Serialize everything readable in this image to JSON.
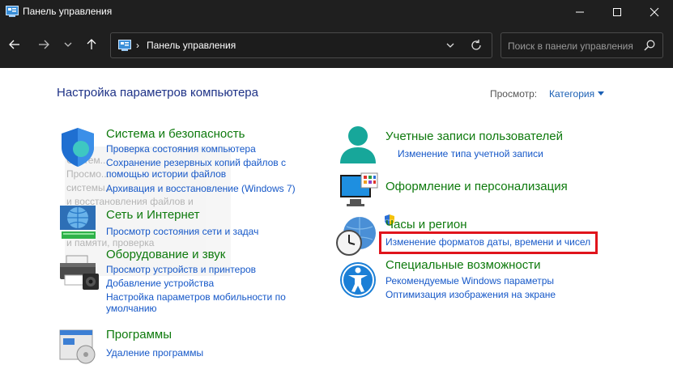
{
  "window": {
    "title": "Панель управления"
  },
  "address_bar": {
    "path": "Панель управления",
    "search_placeholder": "Поиск в панели управления"
  },
  "page": {
    "title": "Настройка параметров компьютера",
    "view_label": "Просмотр:",
    "view_value": "Категория"
  },
  "ghost_tooltip": [
    "Систем...",
    "Просмо...",
    "системы...",
    "и восстановления файлов и",
    "...",
    "и памяти, проверка"
  ],
  "categories": {
    "system": {
      "title": "Система и безопасность",
      "links": [
        "Проверка состояния компьютера",
        "Сохранение резервных копий файлов с",
        "помощью истории файлов",
        "Архивация и восстановление (Windows 7)"
      ]
    },
    "network": {
      "title": "Сеть и Интернет",
      "links": [
        "Просмотр состояния сети и задач"
      ]
    },
    "hardware": {
      "title": "Оборудование и звук",
      "links": [
        "Просмотр устройств и принтеров",
        "Добавление устройства",
        "Настройка параметров мобильности по",
        "умолчанию"
      ]
    },
    "programs": {
      "title": "Программы",
      "links": [
        "Удаление программы"
      ]
    },
    "accounts": {
      "title": "Учетные записи пользователей",
      "links": [
        "Изменение типа учетной записи"
      ]
    },
    "appearance": {
      "title": "Оформление и персонализация",
      "links": []
    },
    "clock": {
      "title": "Часы и регион",
      "links": [
        "Изменение форматов даты, времени и чисел"
      ]
    },
    "access": {
      "title": "Специальные возможности",
      "links": [
        "Рекомендуемые Windows параметры",
        "Оптимизация изображения на экране"
      ]
    }
  },
  "colors": {
    "category_title": "#0e7a0d",
    "link": "#1658c8",
    "highlight": "#e0141c",
    "titlebar": "#1f1f1f"
  }
}
